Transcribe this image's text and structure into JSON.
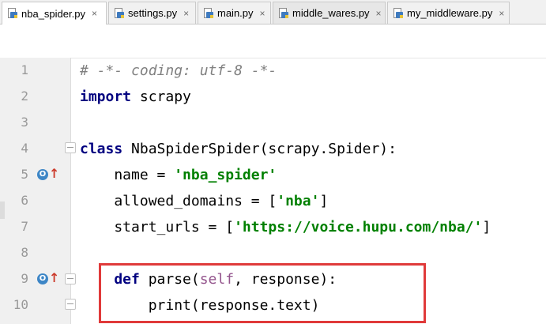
{
  "tabs": [
    {
      "label": "nba_spider.py",
      "active": true
    },
    {
      "label": "settings.py",
      "active": false
    },
    {
      "label": "main.py",
      "active": false
    },
    {
      "label": "middle_wares.py",
      "active": false
    },
    {
      "label": "my_middleware.py",
      "active": false
    }
  ],
  "close_glyph": "×",
  "line_numbers": [
    "1",
    "2",
    "3",
    "4",
    "5",
    "6",
    "7",
    "8",
    "9",
    "10"
  ],
  "code": {
    "l1": "# -*- coding: utf-8 -*-",
    "l2_kw": "import",
    "l2_rest": " scrapy",
    "l4_kw": "class",
    "l4_rest": " NbaSpiderSpider(scrapy.Spider):",
    "l5_a": "    name = ",
    "l5_str": "'nba_spider'",
    "l6_a": "    allowed_domains = [",
    "l6_str": "'nba'",
    "l6_b": "]",
    "l7_a": "    start_urls = [",
    "l7_str": "'https://voice.hupu.com/nba/'",
    "l7_b": "]",
    "l9_kw": "    def",
    "l9_a": " parse(",
    "l9_self": "self",
    "l9_b": ", response):",
    "l10": "        print(response.text)"
  },
  "gutter_marks": {
    "override_letter": "O",
    "arrow": "↑"
  },
  "colors": {
    "keyword": "#000080",
    "string": "#008000",
    "comment": "#808080",
    "self": "#94558d",
    "highlight_border": "#e03a3a"
  }
}
